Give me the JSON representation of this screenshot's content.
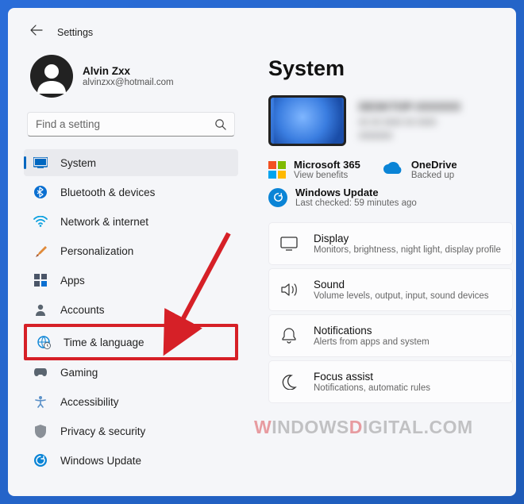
{
  "app": {
    "title": "Settings"
  },
  "user": {
    "name": "Alvin Zxx",
    "email": "alvinzxx@hotmail.com"
  },
  "search": {
    "placeholder": "Find a setting"
  },
  "nav": {
    "items": [
      {
        "label": "System"
      },
      {
        "label": "Bluetooth & devices"
      },
      {
        "label": "Network & internet"
      },
      {
        "label": "Personalization"
      },
      {
        "label": "Apps"
      },
      {
        "label": "Accounts"
      },
      {
        "label": "Time & language"
      },
      {
        "label": "Gaming"
      },
      {
        "label": "Accessibility"
      },
      {
        "label": "Privacy & security"
      },
      {
        "label": "Windows Update"
      }
    ]
  },
  "main": {
    "title": "System",
    "promos": {
      "ms365": {
        "title": "Microsoft 365",
        "sub": "View benefits"
      },
      "onedrive": {
        "title": "OneDrive",
        "sub": "Backed up"
      }
    },
    "update": {
      "title": "Windows Update",
      "sub": "Last checked: 59 minutes ago"
    },
    "cards": [
      {
        "title": "Display",
        "sub": "Monitors, brightness, night light, display profile"
      },
      {
        "title": "Sound",
        "sub": "Volume levels, output, input, sound devices"
      },
      {
        "title": "Notifications",
        "sub": "Alerts from apps and system"
      },
      {
        "title": "Focus assist",
        "sub": "Notifications, automatic rules"
      }
    ]
  },
  "watermark": {
    "part1": "W",
    "part2": "INDOWS",
    "part3": "D",
    "part4": "IGITAL.COM"
  }
}
